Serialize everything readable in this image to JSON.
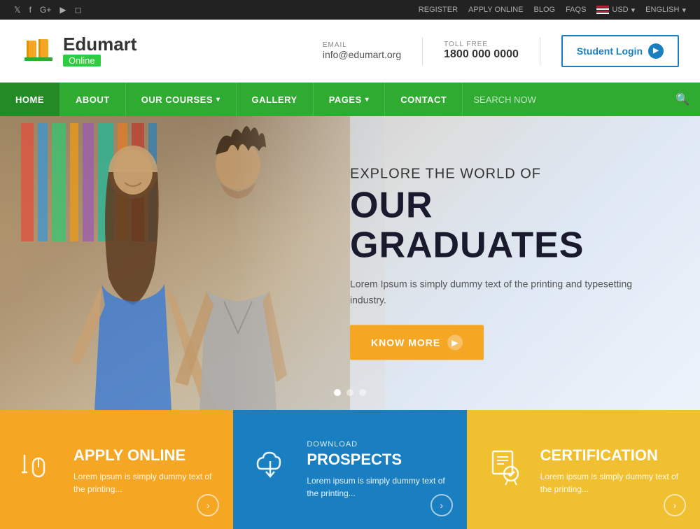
{
  "topbar": {
    "social": [
      "twitter",
      "facebook",
      "google-plus",
      "youtube",
      "instagram"
    ],
    "links": [
      "REGISTER",
      "APPLY ONLINE",
      "BLOG",
      "FAQS"
    ],
    "currency": "USD",
    "language": "ENGLISH"
  },
  "header": {
    "logo_name": "Edumart",
    "logo_sub": "Online",
    "email_label": "EMAIL",
    "email_value": "info@edumart.org",
    "phone_label": "TOLL FREE",
    "phone_value": "1800 000 0000",
    "login_btn": "Student Login"
  },
  "nav": {
    "items": [
      {
        "label": "HOME",
        "has_dropdown": false
      },
      {
        "label": "ABOUT",
        "has_dropdown": false
      },
      {
        "label": "OUR COURSES",
        "has_dropdown": true
      },
      {
        "label": "GALLERY",
        "has_dropdown": false
      },
      {
        "label": "PAGES",
        "has_dropdown": true
      },
      {
        "label": "CONTACT",
        "has_dropdown": false
      }
    ],
    "search_placeholder": "SEARCH NOW"
  },
  "hero": {
    "subtitle": "EXPLORE THE WORLD OF",
    "title": "OUR GRADUATES",
    "description": "Lorem Ipsum is simply dummy text of the printing and typesetting industry.",
    "cta_button": "KNOW MORE",
    "dots": 3,
    "active_dot": 0
  },
  "cards": [
    {
      "id": "apply-online",
      "subtitle": "",
      "title": "APPLY ONLINE",
      "description": "Lorem ipsum is simply dummy text of the printing...",
      "color": "orange"
    },
    {
      "id": "download-prospects",
      "subtitle": "DOWNLOAD",
      "title": "PROSPECTS",
      "description": "Lorem ipsum is simply dummy text of the printing...",
      "color": "blue"
    },
    {
      "id": "certification",
      "subtitle": "",
      "title": "CERTIFICATION",
      "description": "Lorem ipsum is simply dummy text of the printing...",
      "color": "yellow"
    }
  ]
}
